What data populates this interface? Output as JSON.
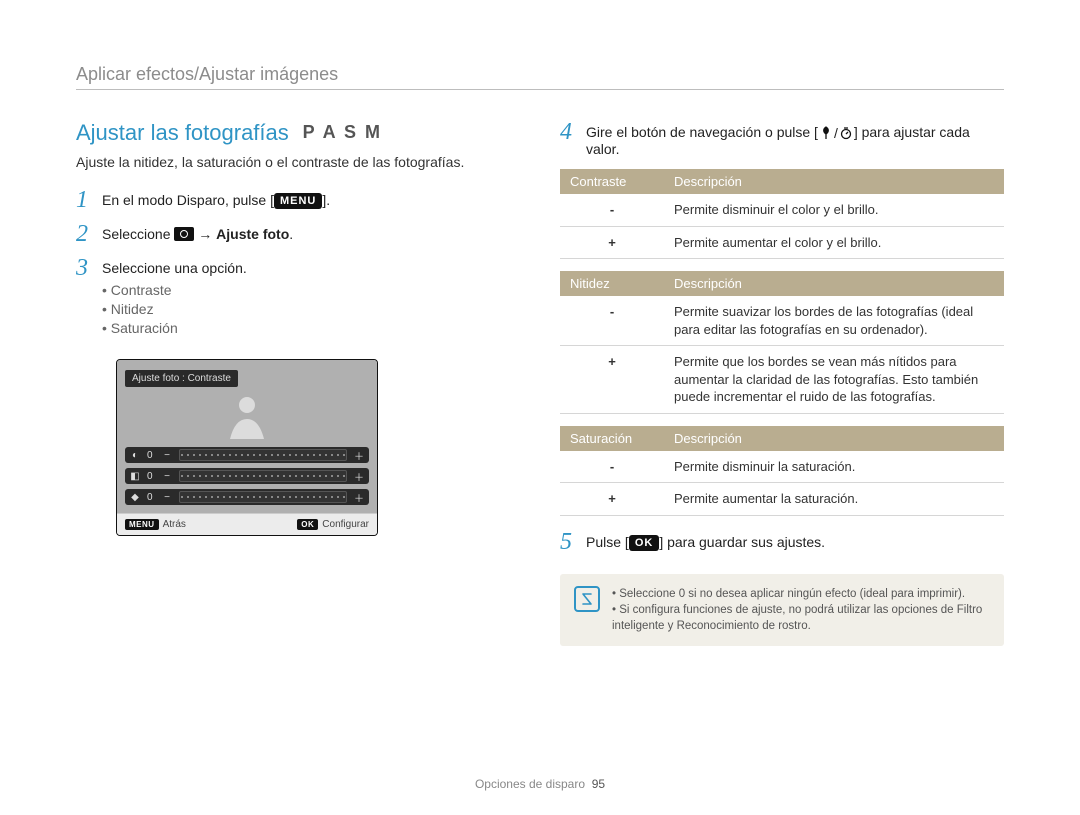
{
  "breadcrumb": "Aplicar efectos/Ajustar imágenes",
  "left": {
    "title": "Ajustar las fotografías",
    "mode_letters": "P A S M",
    "intro": "Ajuste la nitidez, la saturación o el contraste de las fotografías.",
    "step1": {
      "num": "1",
      "pre": "En el modo Disparo, pulse [",
      "badge": "MENU",
      "post": "]."
    },
    "step2": {
      "num": "2",
      "pre": "Seleccione ",
      "arrow": " → ",
      "bold": "Ajuste foto",
      "post": "."
    },
    "step3": {
      "num": "3",
      "text": "Seleccione una opción.",
      "bullets": [
        "Contraste",
        "Nitidez",
        "Saturación"
      ]
    },
    "display": {
      "label": "Ajuste foto : Contraste",
      "zero": "0",
      "foot_back_badge": "MENU",
      "foot_back_label": "Atrás",
      "foot_set_badge": "OK",
      "foot_set_label": "Configurar"
    }
  },
  "right": {
    "step4": {
      "num": "4",
      "pre": "Gire el botón de navegación o pulse [",
      "slash": "/",
      "post": "] para ajustar cada valor."
    },
    "tables": [
      {
        "head_left": "Contraste",
        "head_right": "Descripción",
        "rows": [
          {
            "sym": "-",
            "text": "Permite disminuir el color y el brillo."
          },
          {
            "sym": "+",
            "text": "Permite aumentar el color y el brillo."
          }
        ]
      },
      {
        "head_left": "Nitidez",
        "head_right": "Descripción",
        "rows": [
          {
            "sym": "-",
            "text": "Permite suavizar los bordes de las fotografías (ideal para editar las fotografías en su ordenador)."
          },
          {
            "sym": "+",
            "text": "Permite que los bordes se vean más nítidos para aumentar la claridad de las fotografías. Esto también puede incrementar el ruido de las fotografías."
          }
        ]
      },
      {
        "head_left": "Saturación",
        "head_right": "Descripción",
        "rows": [
          {
            "sym": "-",
            "text": "Permite disminuir la saturación."
          },
          {
            "sym": "+",
            "text": "Permite aumentar la saturación."
          }
        ]
      }
    ],
    "step5": {
      "num": "5",
      "pre": "Pulse [",
      "badge": "OK",
      "post": "] para guardar sus ajustes."
    },
    "notes": [
      "Seleccione 0 si no desea aplicar ningún efecto (ideal para imprimir).",
      "Si configura funciones de ajuste, no podrá utilizar las opciones de Filtro inteligente y Reconocimiento de rostro."
    ]
  },
  "footer": {
    "section": "Opciones de disparo",
    "page": "95"
  }
}
